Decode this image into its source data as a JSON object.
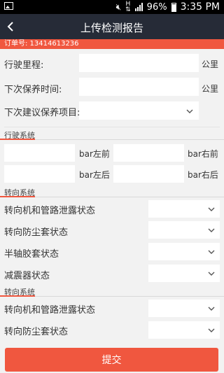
{
  "statusbar": {
    "h_label": "H",
    "battery": "96%",
    "time": "3:35 PM"
  },
  "header": {
    "title": "上传检测报告"
  },
  "order": {
    "text": "订单号:  13414613236"
  },
  "form": {
    "mileage_label": "行驶里程:",
    "mileage_unit": "公里",
    "next_time_label": "下次保养时间:",
    "next_time_unit": "公里",
    "suggest_label": "下次建议保养项目:"
  },
  "sections": {
    "driving": "行驶系统",
    "steering1": "转向系统",
    "steering2": "转向系统"
  },
  "tires": {
    "fl": "bar左前",
    "fr": "bar右前",
    "rl": "bar左后",
    "rr": "bar右后"
  },
  "steering1_items": [
    "转向机和管路泄露状态",
    "转向防尘套状态",
    "半轴胶套状态",
    "减震器状态"
  ],
  "steering2_items": [
    "转向机和管路泄露状态",
    "转向防尘套状态"
  ],
  "submit_label": "提交",
  "colors": {
    "accent": "#f0573f",
    "titlebar": "#262b37"
  }
}
